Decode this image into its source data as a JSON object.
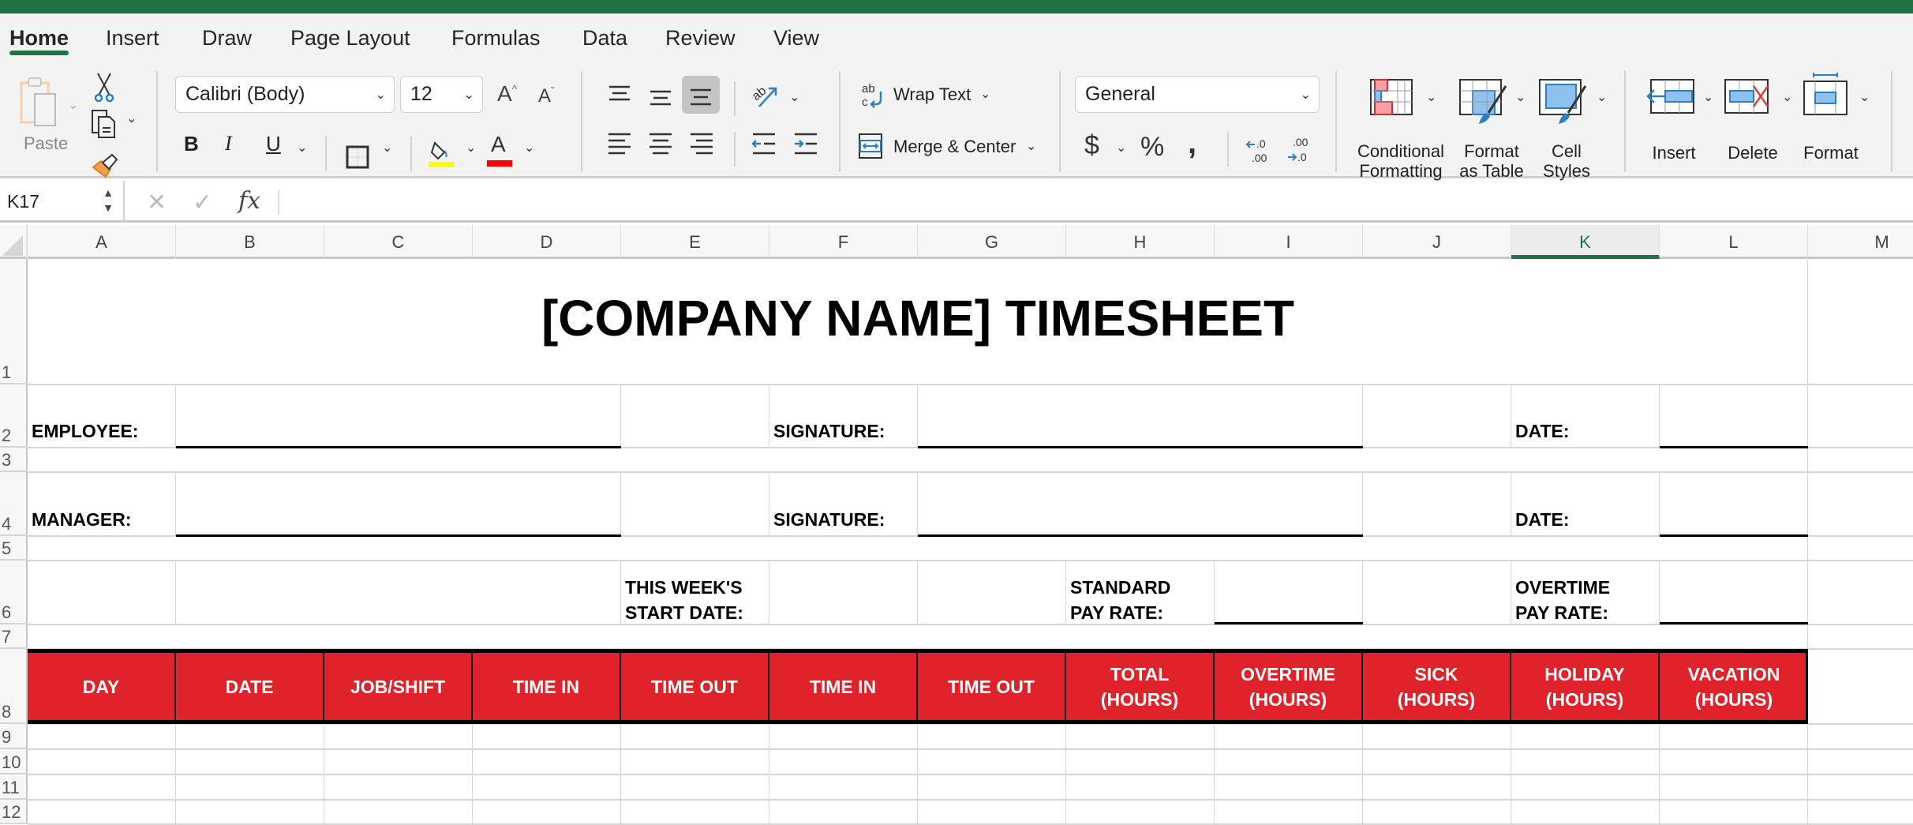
{
  "ribbon": {
    "tabs": [
      {
        "label": "Home",
        "active": true
      },
      {
        "label": "Insert"
      },
      {
        "label": "Draw"
      },
      {
        "label": "Page Layout"
      },
      {
        "label": "Formulas"
      },
      {
        "label": "Data"
      },
      {
        "label": "Review"
      },
      {
        "label": "View"
      }
    ],
    "clipboard": {
      "paste_label": "Paste",
      "icons": [
        "paste-icon",
        "cut-icon",
        "copy-icon",
        "format-painter-icon"
      ]
    },
    "font": {
      "family": "Calibri (Body)",
      "size": "12",
      "highlight_color": "#FFFF00",
      "font_color": "#FF0000"
    },
    "alignment": {
      "wrap_text_label": "Wrap Text",
      "merge_center_label": "Merge & Center",
      "active_vertical_align": "bottom"
    },
    "number": {
      "format": "General",
      "currency_symbol": "$",
      "percent_symbol": "%",
      "comma_symbol": "❟"
    },
    "styles": {
      "conditional_formatting_label_1": "Conditional",
      "conditional_formatting_label_2": "Formatting",
      "format_as_table_label_1": "Format",
      "format_as_table_label_2": "as Table",
      "cell_styles_label_1": "Cell",
      "cell_styles_label_2": "Styles"
    },
    "cells": {
      "insert_label": "Insert",
      "delete_label": "Delete",
      "format_label": "Format"
    }
  },
  "formula_bar": {
    "name_box": "K17",
    "cancel_glyph": "✕",
    "enter_glyph": "✓",
    "fx_label": "fx",
    "content": ""
  },
  "columns": [
    "A",
    "B",
    "C",
    "D",
    "E",
    "F",
    "G",
    "H",
    "I",
    "J",
    "K",
    "L",
    "M"
  ],
  "selected_column": "K",
  "rows": [
    "1",
    "2",
    "3",
    "4",
    "5",
    "6",
    "7",
    "8",
    "9",
    "10",
    "11",
    "12"
  ],
  "sheet": {
    "title": "[COMPANY NAME] TIMESHEET",
    "employee_label": "EMPLOYEE:",
    "manager_label": "MANAGER:",
    "signature_label_1": "SIGNATURE:",
    "signature_label_2": "SIGNATURE:",
    "date_label_1": "DATE:",
    "date_label_2": "DATE:",
    "week_start_label_1": "THIS WEEK'S",
    "week_start_label_2": "START DATE:",
    "standard_rate_label_1": "STANDARD",
    "standard_rate_label_2": "PAY RATE:",
    "overtime_rate_label_1": "OVERTIME",
    "overtime_rate_label_2": "PAY RATE:",
    "header_color": "#E0222B",
    "table_headers": [
      {
        "line1": "DAY",
        "line2": ""
      },
      {
        "line1": "DATE",
        "line2": ""
      },
      {
        "line1": "JOB/SHIFT",
        "line2": ""
      },
      {
        "line1": "TIME IN",
        "line2": ""
      },
      {
        "line1": "TIME OUT",
        "line2": ""
      },
      {
        "line1": "TIME IN",
        "line2": ""
      },
      {
        "line1": "TIME OUT",
        "line2": ""
      },
      {
        "line1": "TOTAL",
        "line2": "(HOURS)"
      },
      {
        "line1": "OVERTIME",
        "line2": "(HOURS)"
      },
      {
        "line1": "SICK",
        "line2": "(HOURS)"
      },
      {
        "line1": "HOLIDAY",
        "line2": "(HOURS)"
      },
      {
        "line1": "VACATION",
        "line2": "(HOURS)"
      }
    ]
  }
}
